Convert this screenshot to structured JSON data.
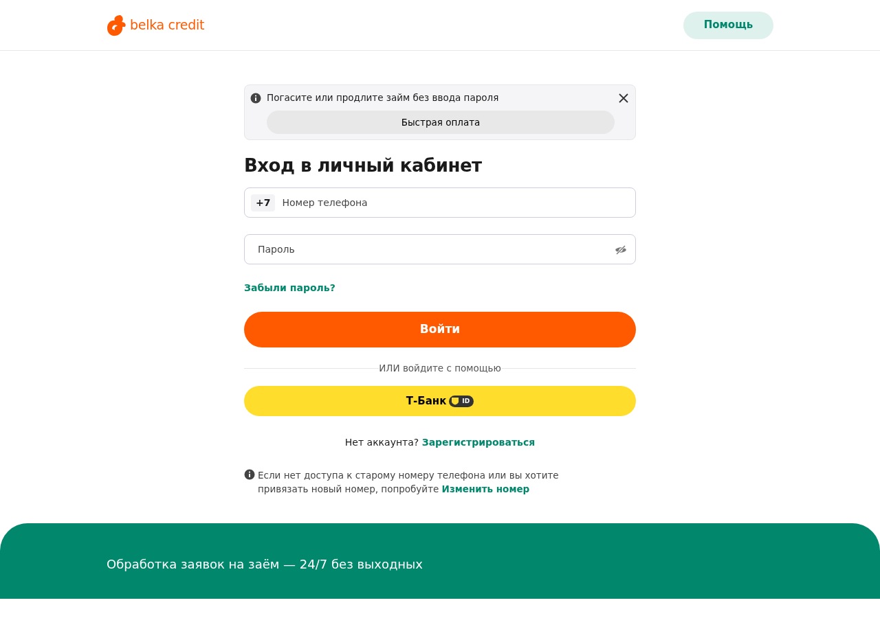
{
  "header": {
    "logo_text": "belka credit",
    "help_button": "Помощь"
  },
  "banner": {
    "text": "Погасите или продлите займ без ввода пароля",
    "button": "Быстрая оплата",
    "closable": true
  },
  "title": "Вход в личный кабинет",
  "phone_field": {
    "prefix": "+7",
    "placeholder": "Номер телефона"
  },
  "password_field": {
    "placeholder": "Пароль",
    "visible": false
  },
  "forgot_link": "Забыли пароль?",
  "login_button": "Войти",
  "divider_text": "ИЛИ войдите с помощью",
  "tbank_button": {
    "label": "Т-Банк",
    "badge": "ID"
  },
  "register": {
    "text": "Нет аккаунта?",
    "link": "Зарегистрироваться"
  },
  "notice": {
    "text": "Если нет доступа к старому номеру телефона или вы хотите привязать новый номер, попробуйте",
    "link": "Изменить номер"
  },
  "footer": {
    "title": "Обработка заявок на заём — 24/7 без выходных"
  }
}
